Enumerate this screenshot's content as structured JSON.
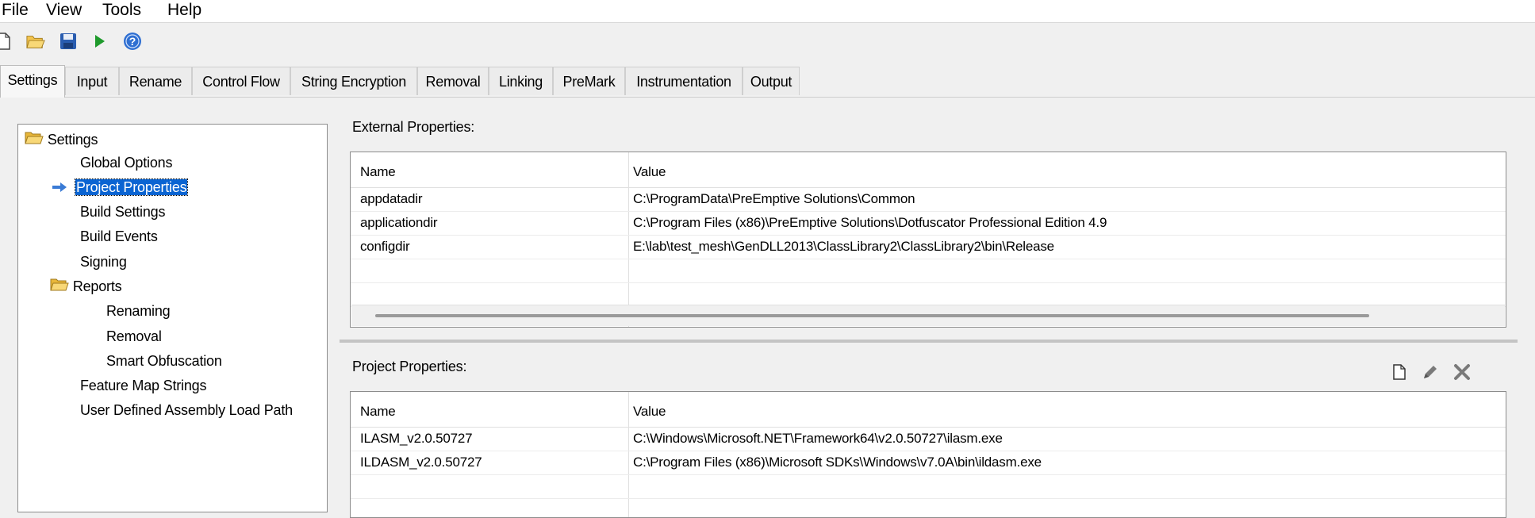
{
  "menu": [
    "File",
    "View",
    "Tools",
    "Help"
  ],
  "toolbar": {
    "new": "new-file-icon",
    "open": "open-folder-icon",
    "save": "save-icon",
    "run": "run-icon",
    "help": "help-icon"
  },
  "tabs": [
    "Settings",
    "Input",
    "Rename",
    "Control Flow",
    "String Encryption",
    "Removal",
    "Linking",
    "PreMark",
    "Instrumentation",
    "Output"
  ],
  "active_tab": "Settings",
  "tree": {
    "root": "Settings",
    "items": [
      "Global Options",
      "Project Properties",
      "Build Settings",
      "Build Events",
      "Signing"
    ],
    "reports": "Reports",
    "report_items": [
      "Renaming",
      "Removal",
      "Smart Obfuscation"
    ],
    "more_items": [
      "Feature Map Strings",
      "User Defined Assembly Load Path"
    ],
    "selected": "Project Properties"
  },
  "external": {
    "label": "External Properties:",
    "col_name": "Name",
    "col_value": "Value",
    "rows": [
      {
        "name": "appdatadir",
        "value": "C:\\ProgramData\\PreEmptive Solutions\\Common"
      },
      {
        "name": "applicationdir",
        "value": "C:\\Program Files (x86)\\PreEmptive Solutions\\Dotfuscator Professional Edition 4.9"
      },
      {
        "name": "configdir",
        "value": "E:\\lab\\test_mesh\\GenDLL2013\\ClassLibrary2\\ClassLibrary2\\bin\\Release"
      }
    ]
  },
  "project": {
    "label": "Project Properties:",
    "col_name": "Name",
    "col_value": "Value",
    "rows": [
      {
        "name": "ILASM_v2.0.50727",
        "value": "C:\\Windows\\Microsoft.NET\\Framework64\\v2.0.50727\\ilasm.exe"
      },
      {
        "name": "ILDASM_v2.0.50727",
        "value": "C:\\Program Files (x86)\\Microsoft SDKs\\Windows\\v7.0A\\bin\\ildasm.exe"
      }
    ]
  },
  "colors": {
    "selection": "#0a64d2",
    "folder": "#f5c542",
    "arrow": "#3a7bd5"
  }
}
